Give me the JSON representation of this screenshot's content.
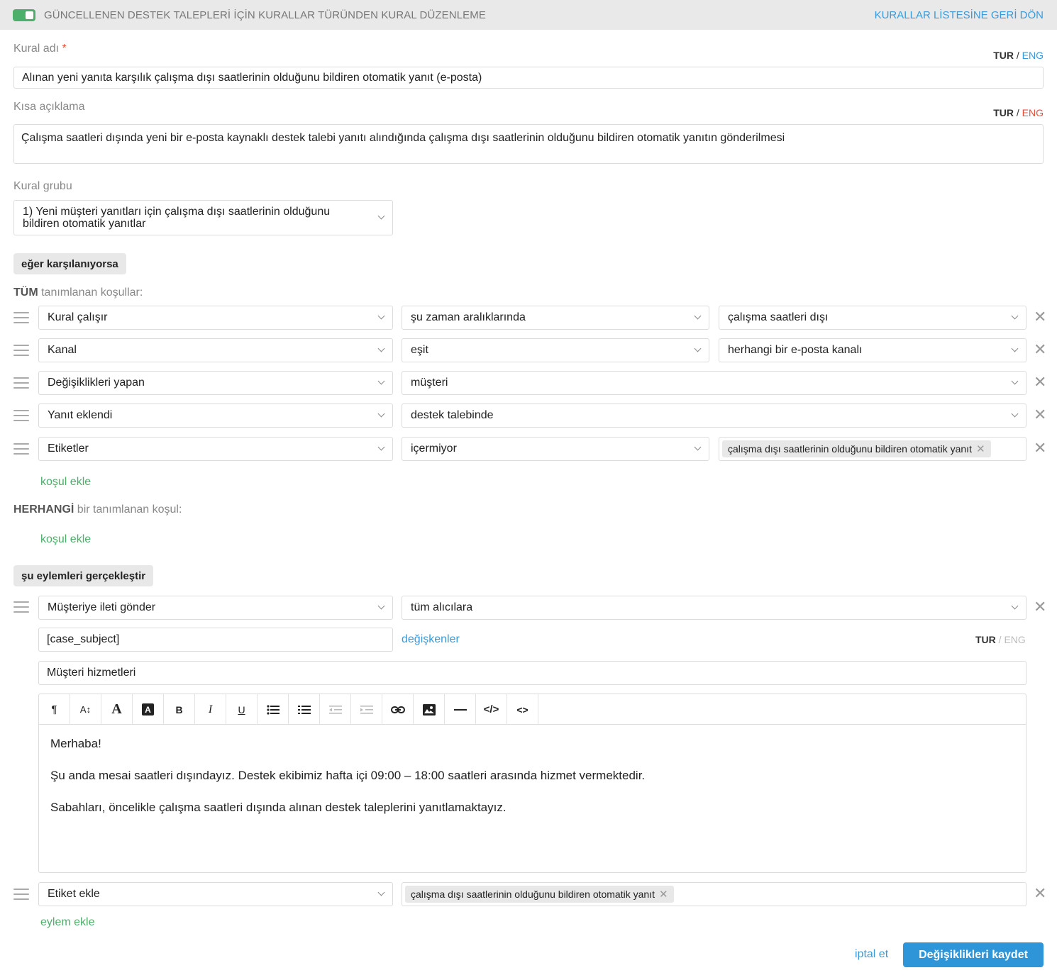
{
  "header": {
    "title": "GÜNCELLENEN DESTEK TALEPLERİ İÇİN KURALLAR TÜRÜNDEN KURAL DÜZENLEME",
    "back_link": "KURALLAR LİSTESİNE GERİ DÖN"
  },
  "lang": {
    "tur": "TUR",
    "sep": "/",
    "eng": "ENG"
  },
  "rule_name": {
    "label": "Kural adı",
    "required_mark": "*",
    "value": "Alınan yeni yanıta karşılık çalışma dışı saatlerinin olduğunu bildiren otomatik yanıt (e-posta)"
  },
  "short_desc": {
    "label": "Kısa açıklama",
    "value": "Çalışma saatleri dışında yeni bir e-posta kaynaklı destek talebi yanıtı alındığında çalışma dışı saatlerinin olduğunu bildiren otomatik yanıtın gönderilmesi"
  },
  "rule_group": {
    "label": "Kural grubu",
    "value": "1) Yeni müşteri yanıtları için çalışma dışı saatlerinin olduğunu bildiren otomatik yanıtlar"
  },
  "if_section": {
    "pill": "eğer karşılanıyorsa",
    "all_bold": "TÜM",
    "all_rest": " tanımlanan koşullar:",
    "any_bold": "HERHANGİ",
    "any_rest": " bir tanımlanan koşul:",
    "add_condition": "koşul ekle"
  },
  "conditions": [
    {
      "field": "Kural çalışır",
      "op": "şu zaman aralıklarında",
      "value": "çalışma saatleri dışı"
    },
    {
      "field": "Kanal",
      "op": "eşit",
      "value": "herhangi bir e-posta kanalı"
    },
    {
      "field": "Değişiklikleri yapan",
      "value": "müşteri"
    },
    {
      "field": "Yanıt eklendi",
      "value": "destek talebinde"
    },
    {
      "field": "Etiketler",
      "op": "içermiyor",
      "tag": "çalışma dışı saatlerinin olduğunu bildiren otomatik yanıt"
    }
  ],
  "actions_section": {
    "pill": "şu eylemleri gerçekleştir",
    "add_action": "eylem ekle"
  },
  "action1": {
    "type": "Müşteriye ileti gönder",
    "target": "tüm alıcılara",
    "subject": "[case_subject]",
    "variables_link": "değişkenler",
    "sender": "Müşteri hizmetleri",
    "body": [
      "Merhaba!",
      "Şu anda mesai saatleri dışındayız. Destek ekibimiz hafta içi 09:00 – 18:00 saatleri arasında hizmet vermektedir.",
      "Sabahları, öncelikle çalışma saatleri dışında alınan destek taleplerini yanıtlamaktayız."
    ]
  },
  "toolbar": {
    "paragraph": "¶",
    "font_size": "A↕",
    "font_color": "A",
    "bg_color": "A",
    "bold": "B",
    "italic": "I",
    "underline": "U",
    "code_view": "</>",
    "embed": "<>"
  },
  "action2": {
    "type": "Etiket ekle",
    "tag": "çalışma dışı saatlerinin olduğunu bildiren otomatik yanıt"
  },
  "footer": {
    "cancel": "iptal et",
    "save": "Değişiklikleri kaydet"
  },
  "colors": {
    "accent_blue": "#2e96d8",
    "link_blue": "#3a9ad9",
    "green": "#4caf6a",
    "required_red": "#e74c3c"
  }
}
